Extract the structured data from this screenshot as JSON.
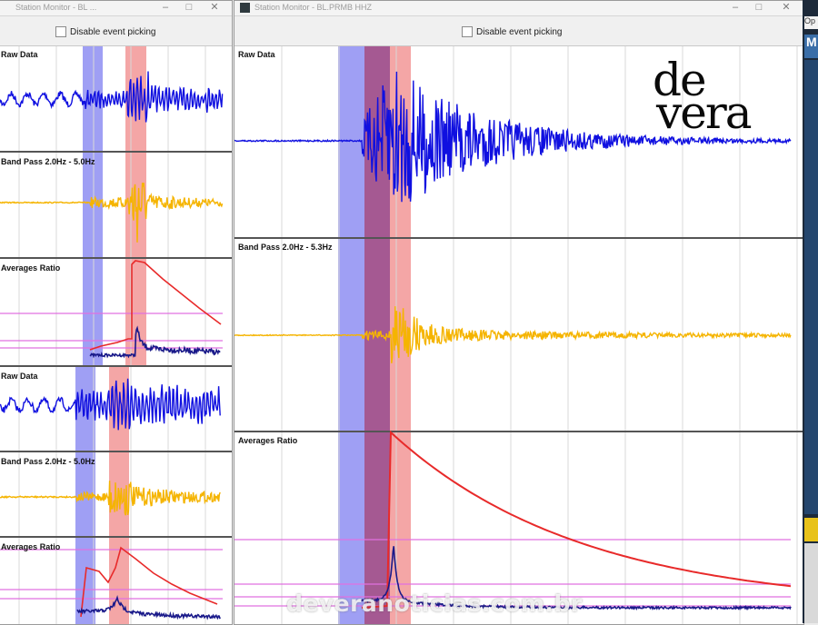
{
  "windows": {
    "left": {
      "title": "Station Monitor - BL ...",
      "disable_picking_label": "Disable event picking",
      "panels": {
        "raw_data": "Raw Data",
        "band_pass": "Band Pass 2.0Hz - 5.0Hz",
        "averages_ratio": "Averages Ratio"
      },
      "panels2": {
        "raw_data": "Raw Data",
        "band_pass": "Band Pass 2.0Hz - 5.0Hz",
        "averages_ratio": "Averages Ratio"
      }
    },
    "right": {
      "title": "Station Monitor - BL.PRMB HHZ",
      "disable_picking_label": "Disable event picking",
      "panels": {
        "raw_data": "Raw Data",
        "band_pass": "Band Pass 2.0Hz - 5.3Hz",
        "averages_ratio": "Averages Ratio"
      }
    },
    "third": {
      "title_fragment": "Op",
      "label": "M"
    }
  },
  "overlays": {
    "logo_line1": "de",
    "logo_line2": "vera",
    "watermark": "deveranoticias.com.br"
  },
  "colors": {
    "raw_trace": "#1010e0",
    "bandpass_trace": "#f5b400",
    "ratio_line": "#e82a2a",
    "short_avg": "#1a1a8a",
    "threshold": "#e070e0",
    "blue_window": "#8e8ef2",
    "red_window": "#f29696",
    "grid": "#d8d8d8"
  }
}
